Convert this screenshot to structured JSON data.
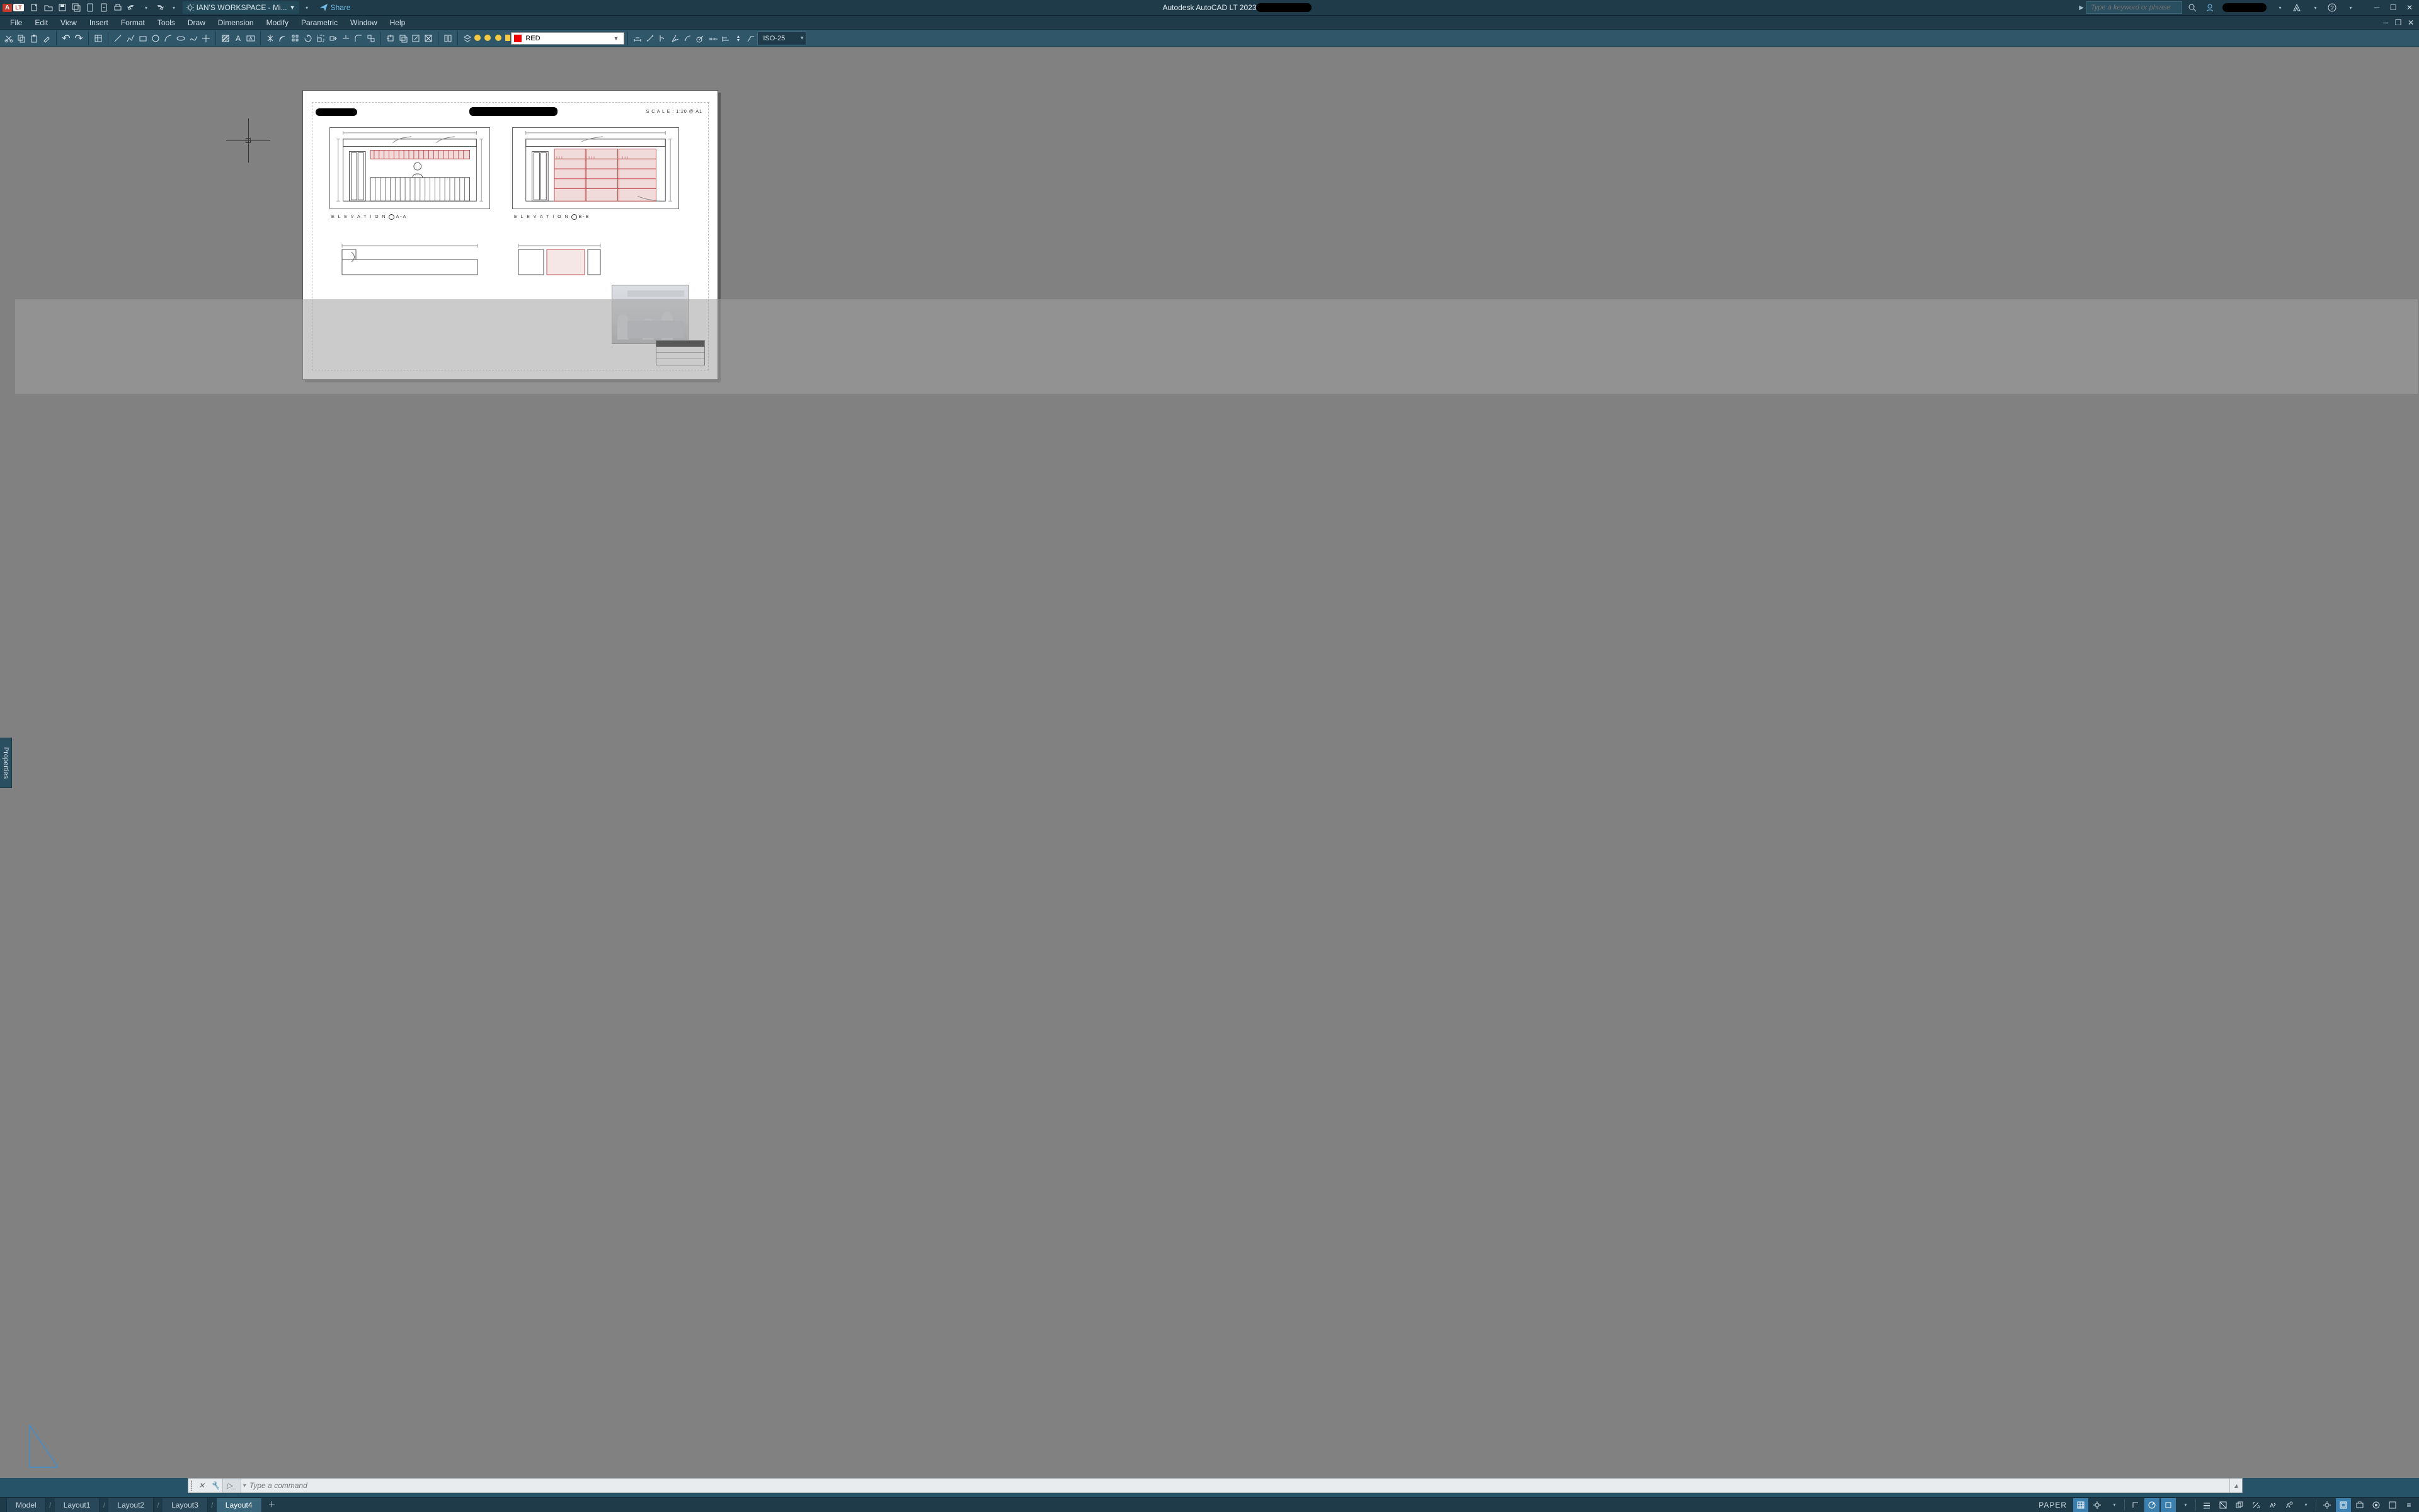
{
  "titlebar": {
    "app_badge": "A",
    "lt_badge": "LT",
    "workspace_label": "IAN'S WORKSPACE - Mi...",
    "share_label": "Share",
    "app_title": "Autodesk AutoCAD LT 2023",
    "search_placeholder": "Type a keyword or phrase"
  },
  "menus": {
    "file": "File",
    "edit": "Edit",
    "view": "View",
    "insert": "Insert",
    "format": "Format",
    "tools": "Tools",
    "draw": "Draw",
    "dimension": "Dimension",
    "modify": "Modify",
    "parametric": "Parametric",
    "window": "Window",
    "help": "Help"
  },
  "layer": {
    "current": "RED"
  },
  "dimstyle": {
    "current": "ISO-25"
  },
  "properties_tab": "Properties",
  "sheet": {
    "scale_label": "S C A L E :   1:20 @ A1",
    "elev_a": "E L E V A T I O N",
    "elev_a_tag": "A-A",
    "elev_b": "E L E V A T I O N",
    "elev_b_tag": "B-B"
  },
  "command": {
    "placeholder": "Type a command"
  },
  "tabs": {
    "model": "Model",
    "layout1": "Layout1",
    "layout2": "Layout2",
    "layout3": "Layout3",
    "layout4": "Layout4"
  },
  "status": {
    "space": "PAPER"
  }
}
